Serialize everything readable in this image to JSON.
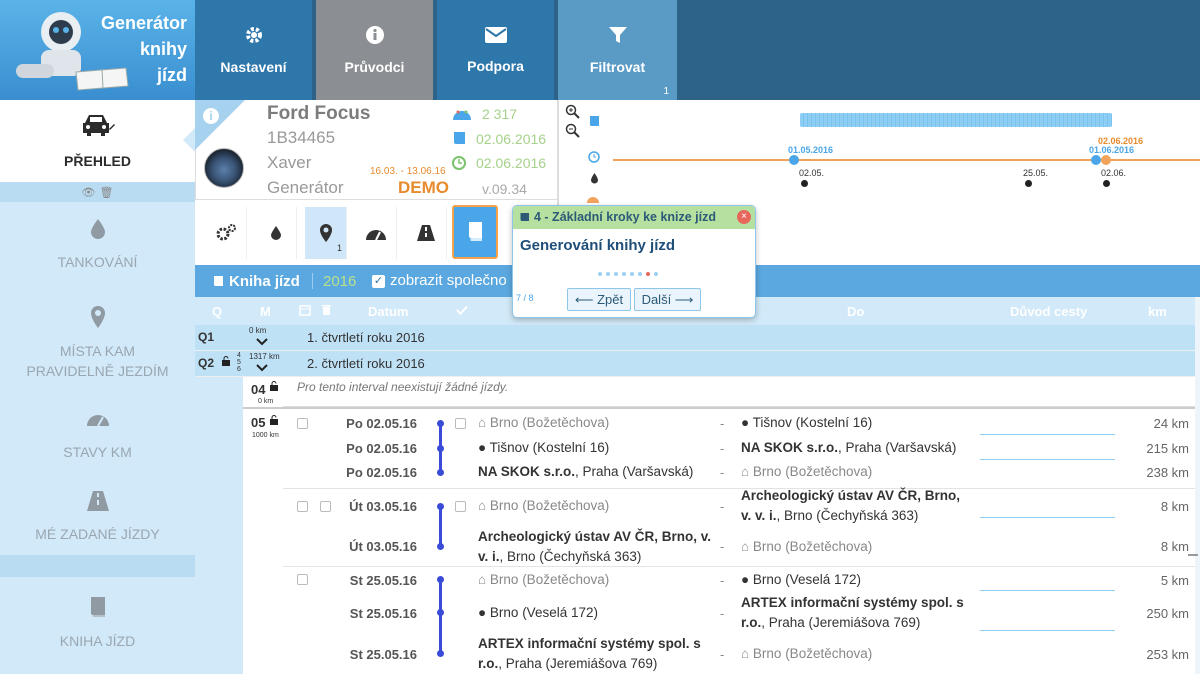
{
  "app": {
    "title_line1": "Generátor",
    "title_line2": "knihy",
    "title_line3": "jízd"
  },
  "topnav": {
    "nastaveni": "Nastavení",
    "pruvodci": "Průvodci",
    "podpora": "Podpora",
    "filtrovat": "Filtrovat",
    "filtrovat_count": "1"
  },
  "sidebar": {
    "prehled": "PŘEHLED",
    "tankovani": "TANKOVÁNÍ",
    "mista_line1": "MÍSTA KAM",
    "mista_line2": "PRAVIDELNĚ JEZDÍM",
    "stavy": "STAVY KM",
    "zadane": "MÉ ZADANÉ JÍZDY",
    "kniha": "KNIHA JÍZD"
  },
  "car": {
    "name": "Ford Focus",
    "plate": "1B34465",
    "driver": "Xaver",
    "company": "Generátor",
    "period": "16.03. - 13.06.16",
    "demo": "DEMO",
    "km": "2 317",
    "book_date": "02.06.2016",
    "clock_date": "02.06.2016",
    "version": "v.09.34"
  },
  "toolbar": {
    "pin_count": "1"
  },
  "timeline": {
    "date_blue_1": "01.05.2016",
    "date_blue_2": "01.06.2016",
    "date_orange": "02.06.2016",
    "tick_1": "02.05.",
    "tick_2": "25.05.",
    "tick_3": "02.06."
  },
  "kniha": {
    "title": "Kniha jízd",
    "year": "2016",
    "show_company": "zobrazit společno"
  },
  "columns": {
    "q": "Q",
    "m": "M",
    "datum": "Datum",
    "do": "Do",
    "duvod": "Důvod cesty",
    "km": "km"
  },
  "quarters": {
    "q1_label": "Q1",
    "q1_km": "0 km",
    "q1_title": "1. čtvrtletí roku 2016",
    "q2_label": "Q2",
    "q2_months": "4 5 6",
    "q2_km": "1317 km",
    "q2_title": "2. čtvrtletí roku 2016"
  },
  "month04": {
    "num": "04",
    "km": "0 km",
    "empty": "Pro tento interval neexistují žádné jízdy."
  },
  "month05": {
    "num": "05",
    "km": "1000 km"
  },
  "trips": [
    {
      "date": "Po 02.05.16",
      "from_name": "",
      "from_place": "Brno (Božetěchova)",
      "to_name": "",
      "to_place": "Tišnov (Kostelní 16)",
      "km": "24 km"
    },
    {
      "date": "Po 02.05.16",
      "from_name": "",
      "from_place": "Tišnov (Kostelní 16)",
      "to_name": "NA SKOK s.r.o.",
      "to_place": ", Praha (Varšavská)",
      "km": "215 km"
    },
    {
      "date": "Po 02.05.16",
      "from_name": "NA SKOK s.r.o.",
      "from_place": ", Praha (Varšavská)",
      "to_name": "",
      "to_place": "Brno (Božetěchova)",
      "km": "238 km"
    },
    {
      "date": "Út 03.05.16",
      "from_name": "",
      "from_place": "Brno (Božetěchova)",
      "to_name": "Archeologický ústav AV ČR, Brno, v. v. i.",
      "to_place": ", Brno (Čechyňská 363)",
      "km": "8 km"
    },
    {
      "date": "Út 03.05.16",
      "from_name": "Archeologický ústav AV ČR, Brno, v. v. i.",
      "from_place": ", Brno (Čechyňská 363)",
      "to_name": "",
      "to_place": "Brno (Božetěchova)",
      "km": "8 km"
    },
    {
      "date": "St 25.05.16",
      "from_name": "",
      "from_place": "Brno (Božetěchova)",
      "to_name": "",
      "to_place": "Brno (Veselá 172)",
      "km": "5 km"
    },
    {
      "date": "St 25.05.16",
      "from_name": "",
      "from_place": "Brno (Veselá 172)",
      "to_name": "ARTEX informační systémy spol. s r.o.",
      "to_place": ", Praha (Jeremiášova 769)",
      "km": "250 km"
    },
    {
      "date": "St 25.05.16",
      "from_name": "ARTEX informační systémy spol. s r.o.",
      "from_place": ", Praha (Jeremiášova 769)",
      "to_name": "",
      "to_place": "Brno (Božetěchova)",
      "km": "253 km"
    }
  ],
  "tooltip": {
    "header": "4 - Základní kroky ke knize jízd",
    "body": "Generování knihy jízd",
    "counter": "7 / 8",
    "back": "⟵ Zpět",
    "next": "Další ⟶",
    "close": "×"
  }
}
